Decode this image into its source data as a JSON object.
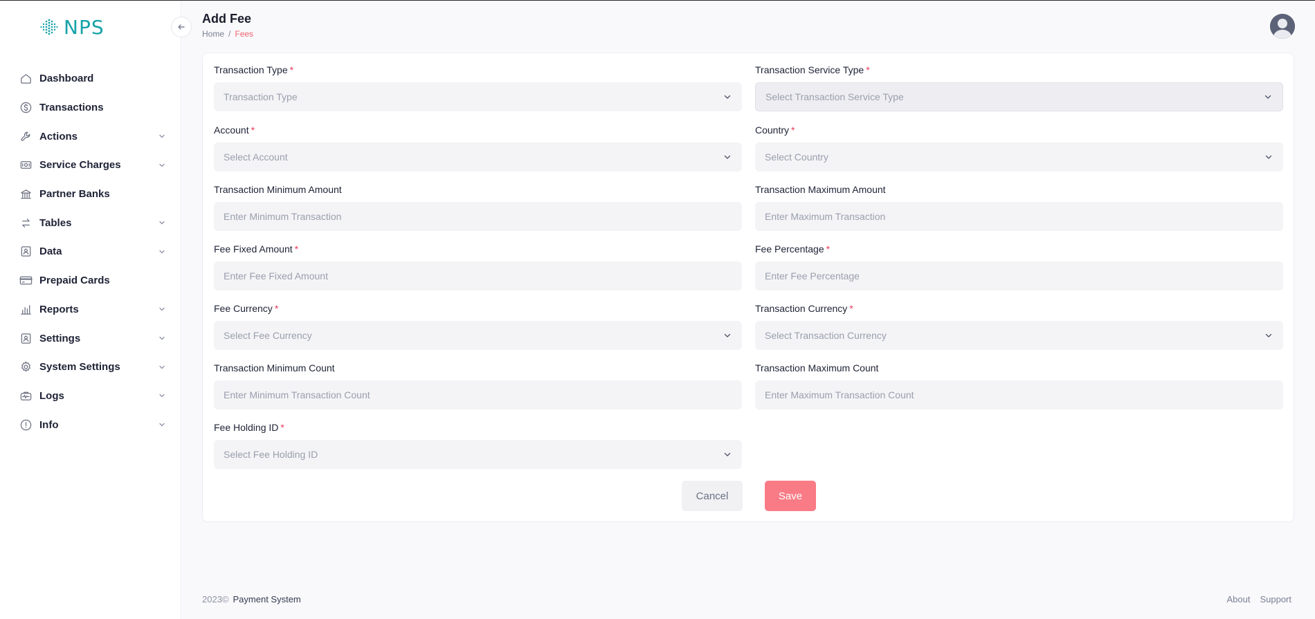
{
  "app": {
    "logo_text": "NPS"
  },
  "sidebar": {
    "items": [
      {
        "label": "Dashboard",
        "icon": "home-icon",
        "expandable": false
      },
      {
        "label": "Transactions",
        "icon": "dollar-icon",
        "expandable": false
      },
      {
        "label": "Actions",
        "icon": "wrench-icon",
        "expandable": true
      },
      {
        "label": "Service Charges",
        "icon": "cash-icon",
        "expandable": true
      },
      {
        "label": "Partner Banks",
        "icon": "bank-icon",
        "expandable": false
      },
      {
        "label": "Tables",
        "icon": "arrows-icon",
        "expandable": true
      },
      {
        "label": "Data",
        "icon": "id-card-icon",
        "expandable": true
      },
      {
        "label": "Prepaid Cards",
        "icon": "credit-card-icon",
        "expandable": false
      },
      {
        "label": "Reports",
        "icon": "bar-chart-icon",
        "expandable": true
      },
      {
        "label": "Settings",
        "icon": "user-square-icon",
        "expandable": true
      },
      {
        "label": "System Settings",
        "icon": "gear-icon",
        "expandable": true
      },
      {
        "label": "Logs",
        "icon": "logs-icon",
        "expandable": true
      },
      {
        "label": "Info",
        "icon": "info-icon",
        "expandable": true
      }
    ]
  },
  "header": {
    "title": "Add Fee",
    "breadcrumb": {
      "home": "Home",
      "separator": "/",
      "current": "Fees"
    }
  },
  "form": {
    "fields": [
      {
        "key": "transaction_type",
        "label": "Transaction Type",
        "required": true,
        "type": "select",
        "placeholder": "Transaction Type"
      },
      {
        "key": "transaction_service_type",
        "label": "Transaction Service Type",
        "required": true,
        "type": "select",
        "placeholder": "Select Transaction Service Type",
        "disabled": true
      },
      {
        "key": "account",
        "label": "Account",
        "required": true,
        "type": "select",
        "placeholder": "Select Account"
      },
      {
        "key": "country",
        "label": "Country",
        "required": true,
        "type": "select",
        "placeholder": "Select Country"
      },
      {
        "key": "transaction_min_amount",
        "label": "Transaction Minimum Amount",
        "required": false,
        "type": "input",
        "placeholder": "Enter Minimum Transaction"
      },
      {
        "key": "transaction_max_amount",
        "label": "Transaction Maximum Amount",
        "required": false,
        "type": "input",
        "placeholder": "Enter Maximum Transaction"
      },
      {
        "key": "fee_fixed_amount",
        "label": "Fee Fixed Amount",
        "required": true,
        "type": "input",
        "placeholder": "Enter Fee Fixed Amount"
      },
      {
        "key": "fee_percentage",
        "label": "Fee Percentage",
        "required": true,
        "type": "input",
        "placeholder": "Enter Fee Percentage"
      },
      {
        "key": "fee_currency",
        "label": "Fee Currency",
        "required": true,
        "type": "select",
        "placeholder": "Select Fee Currency"
      },
      {
        "key": "transaction_currency",
        "label": "Transaction Currency",
        "required": true,
        "type": "select",
        "placeholder": "Select Transaction Currency"
      },
      {
        "key": "transaction_min_count",
        "label": "Transaction Minimum Count",
        "required": false,
        "type": "input",
        "placeholder": "Enter Minimum Transaction Count"
      },
      {
        "key": "transaction_max_count",
        "label": "Transaction Maximum Count",
        "required": false,
        "type": "input",
        "placeholder": "Enter Maximum Transaction Count"
      },
      {
        "key": "fee_holding_id",
        "label": "Fee Holding ID",
        "required": true,
        "type": "select",
        "placeholder": "Select Fee Holding ID"
      }
    ],
    "required_marker": "*",
    "cancel_label": "Cancel",
    "save_label": "Save"
  },
  "footer": {
    "year": "2023©",
    "brand": "Payment System",
    "links": [
      "About",
      "Support"
    ]
  },
  "colors": {
    "accent": "#17a2a8",
    "breadcrumb_active": "#f0616e",
    "required": "#e8395a",
    "save_button": "#f97b86"
  }
}
